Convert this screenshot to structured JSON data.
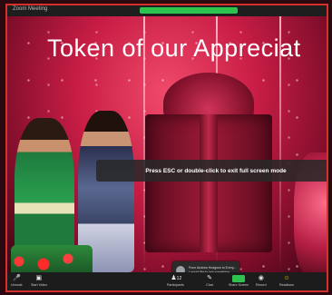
{
  "window": {
    "app_label": "Zoom Meeting"
  },
  "slide": {
    "title": "Token of our Appreciat"
  },
  "notice": {
    "fullscreen_hint": "Press ESC or double-click to exit full screen mode"
  },
  "chat_popup": {
    "line1": "From Andrew Hodgson to Every...",
    "line2": "I would like to see something"
  },
  "toolbar": {
    "items": [
      {
        "icon": "mic-icon",
        "label": "Unmute"
      },
      {
        "icon": "video-icon",
        "label": "Start Video"
      },
      {
        "icon": "participants-icon",
        "label": "Participants"
      },
      {
        "icon": "chat-icon",
        "label": "Chat"
      },
      {
        "icon": "share-screen-icon",
        "label": "Share Screen"
      },
      {
        "icon": "record-icon",
        "label": "Record"
      },
      {
        "icon": "reactions-icon",
        "label": "Reactions"
      }
    ],
    "participant_count": "12"
  },
  "colors": {
    "share_green": "#2ec24f",
    "frame_border": "#d2312c",
    "slide_bg": "#c81d45"
  }
}
